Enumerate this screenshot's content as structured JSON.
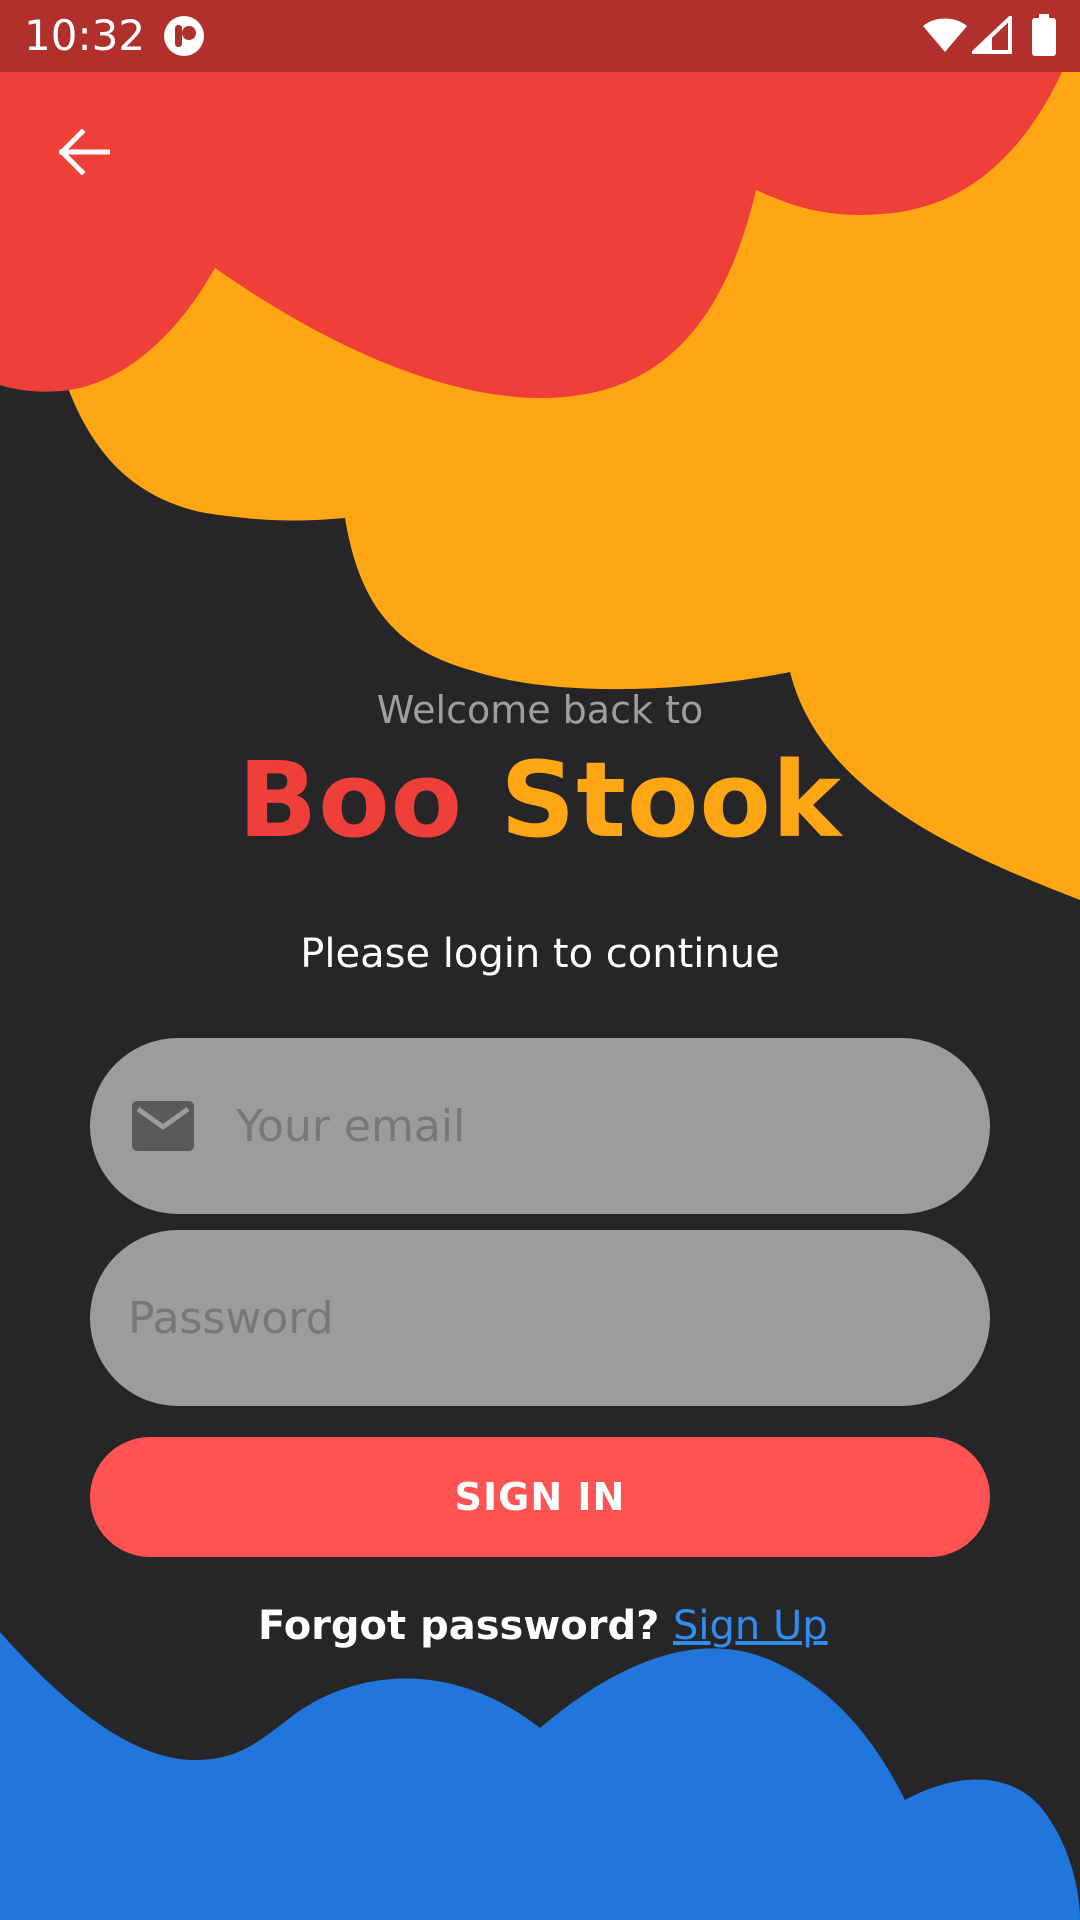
{
  "status_bar": {
    "time": "10:32",
    "app_icon": "app-notification-icon",
    "wifi_icon": "wifi-icon",
    "signal_icon": "cell-signal-icon",
    "battery_icon": "battery-icon"
  },
  "header": {
    "back_icon": "arrow-back-icon"
  },
  "hero": {
    "welcome_text": "Welcome back to",
    "brand_part_1": "Boo",
    "brand_part_2": "Stook",
    "subtitle": "Please login to continue"
  },
  "form": {
    "email_placeholder": "Your email",
    "email_value": "",
    "email_icon": "mail-icon",
    "password_placeholder": "Password",
    "password_value": "",
    "signin_label": "SIGN IN"
  },
  "footer": {
    "forgot_label": "Forgot password?",
    "signup_label": "Sign Up"
  },
  "colors": {
    "background": "#262628",
    "status_bar": "#B2302B",
    "red_blob": "#EE4038",
    "orange_blob": "#FFA615",
    "blue_blob": "#2076DA",
    "input_fill": "#9C9C9C",
    "signin_button": "#FF5252",
    "signup_link": "#2F8EF0"
  }
}
